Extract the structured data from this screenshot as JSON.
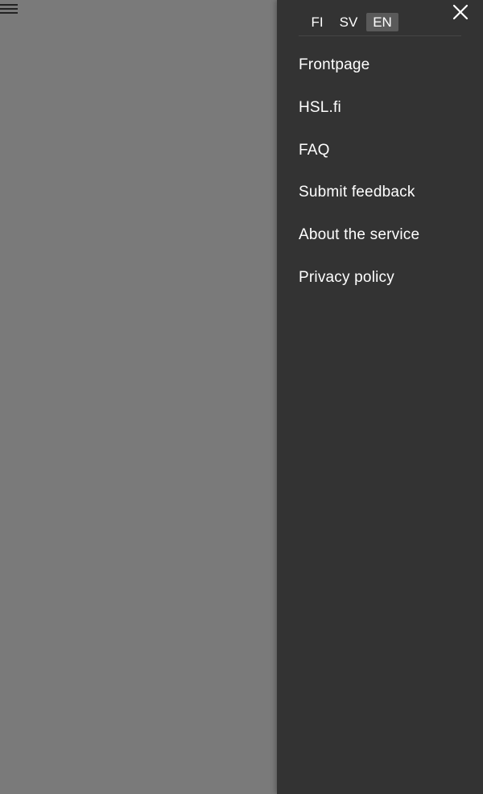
{
  "header": {
    "menu_icon": "hamburger-menu-icon"
  },
  "drawer": {
    "languages": [
      {
        "label": "FI",
        "selected": false
      },
      {
        "label": "SV",
        "selected": false
      },
      {
        "label": "EN",
        "selected": true
      }
    ],
    "close_icon": "close-icon",
    "items": [
      {
        "label": "Frontpage"
      },
      {
        "label": "HSL.fi"
      },
      {
        "label": "FAQ"
      },
      {
        "label": "Submit feedback"
      },
      {
        "label": "About the service"
      },
      {
        "label": "Privacy policy"
      }
    ]
  },
  "colors": {
    "overlay": "#7a7a7a",
    "drawer_background": "#333333",
    "selected_language_background": "#5a5a5a",
    "text": "#ffffff"
  }
}
